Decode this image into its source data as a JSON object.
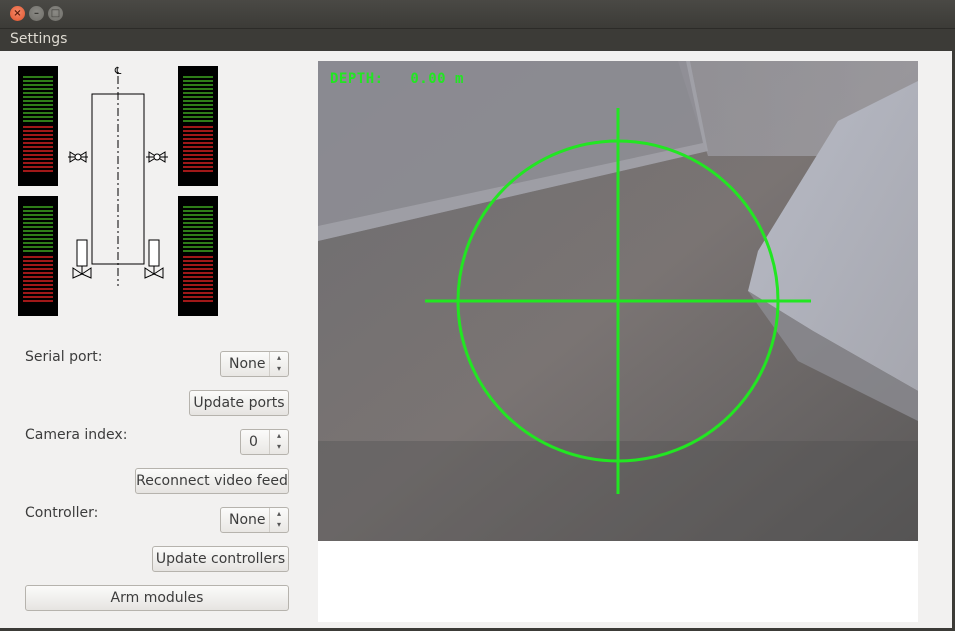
{
  "window": {
    "buttons": [
      "close",
      "minimize",
      "maximize"
    ]
  },
  "menubar": {
    "settings_label": "Settings"
  },
  "thrusters": {
    "centerline_label": "℄",
    "meters": [
      "front-left",
      "front-right",
      "rear-left",
      "rear-right"
    ],
    "colors": {
      "active": "#2e7d18",
      "reverse": "#a01818"
    }
  },
  "controls": {
    "serial_port_label": "Serial port:",
    "serial_port_value": "None",
    "update_ports_label": "Update ports",
    "camera_index_label": "Camera index:",
    "camera_index_value": "0",
    "reconnect_label": "Reconnect video feed",
    "controller_label": "Controller:",
    "controller_value": "None",
    "update_controllers_label": "Update controllers",
    "arm_label": "Arm modules"
  },
  "video": {
    "depth_label": "DEPTH:",
    "depth_value": "0.00 m",
    "overlay_color": "#22e622"
  }
}
